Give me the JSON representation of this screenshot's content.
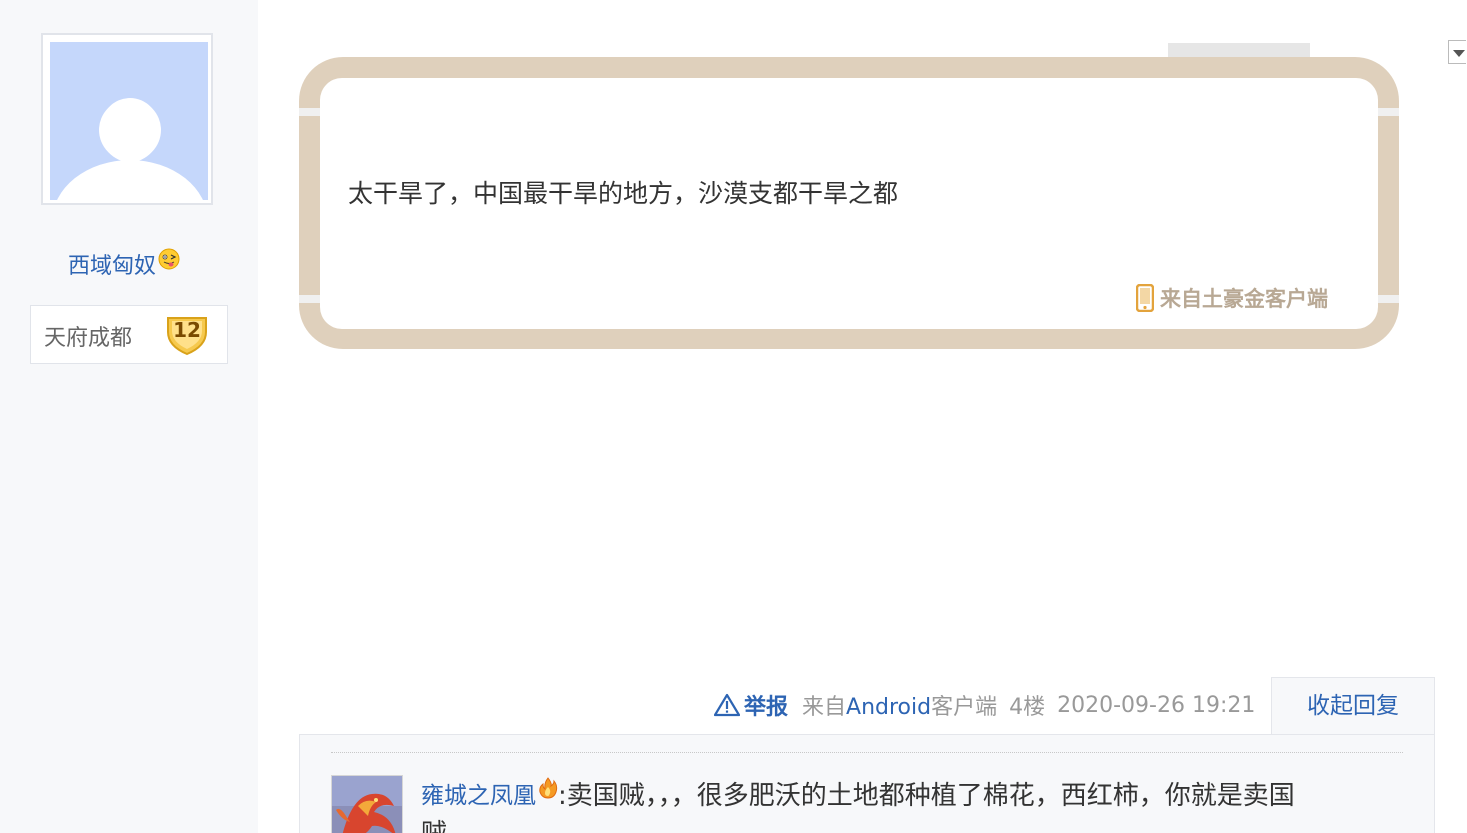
{
  "user": {
    "name": "西域匈奴",
    "forum_name": "天府成都",
    "level": "12",
    "avatar_icon": "default-avatar-icon",
    "emoji_icon": "tongue-out-emoji-icon"
  },
  "post": {
    "text": "太干旱了，中国最干旱的地方，沙漠支都干旱之都",
    "client_tag": "来自土豪金客户端",
    "client_icon": "phone-icon"
  },
  "meta": {
    "report_label": "举报",
    "client_prefix": "来自",
    "client_name": "Android",
    "client_suffix": "客户端",
    "floor": "4楼",
    "datetime": "2020-09-26 19:21",
    "collapse_label": "收起回复"
  },
  "reply": {
    "user": "雍城之凤凰",
    "text": ":卖国贼，，，很多肥沃的土地都种植了棉花，西红柿，你就是卖国",
    "text_cont": "贼"
  },
  "colors": {
    "link": "#2d64b3",
    "bubble_border": "#dfd0bc",
    "meta_gray": "#999999",
    "sidebar_bg": "#f7f8fa"
  }
}
